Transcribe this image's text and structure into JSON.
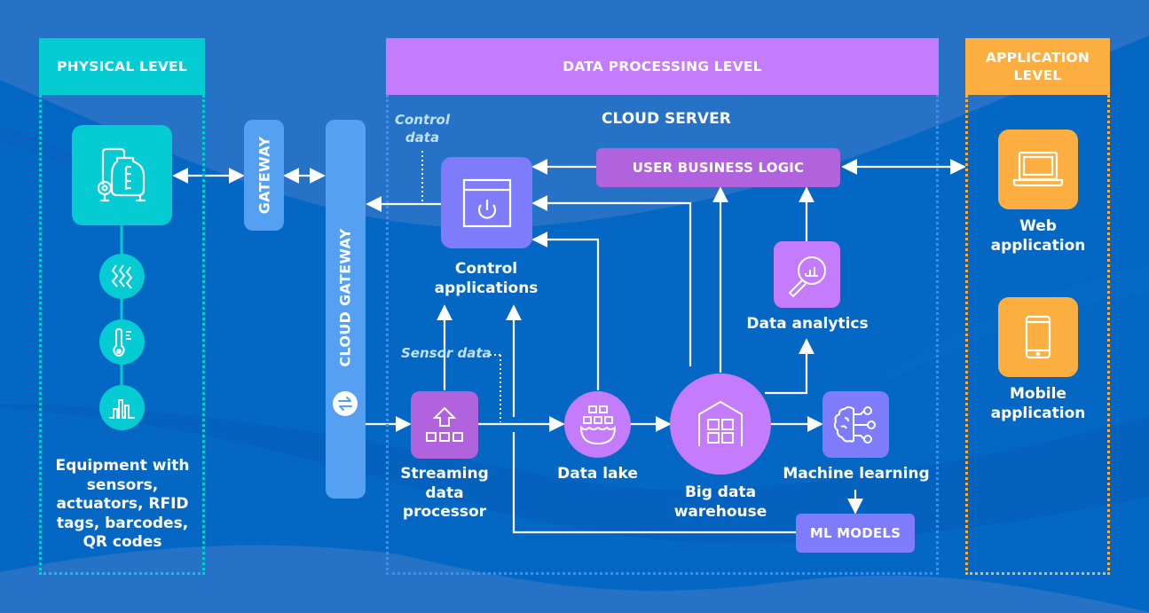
{
  "colors": {
    "background": "#0567c4",
    "background_light": "#2672c6",
    "physical": "#05cbd3",
    "processing_header": "#c47bfc",
    "application": "#fcaf40",
    "gateway": "#55a0f1",
    "control_tile": "#7e7cfb",
    "business_logic": "#b162dd",
    "analytics": "#c47bfc",
    "streaming": "#b162dd",
    "ml_tile": "#7e7cfb",
    "ml_models": "#7e7cfb"
  },
  "levels": {
    "physical": {
      "title": "PHYSICAL LEVEL"
    },
    "processing": {
      "title": "DATA PROCESSING LEVEL",
      "subtitle": "CLOUD SERVER"
    },
    "application": {
      "title": "APPLICATION LEVEL"
    }
  },
  "physical": {
    "equipment_icon": "industrial-tank-icon",
    "sensors": [
      {
        "icon": "vibration-icon"
      },
      {
        "icon": "thermometer-icon"
      },
      {
        "icon": "bar-chart-icon"
      }
    ],
    "description": "Equipment with sensors, actuators, RFID tags, barcodes, QR codes"
  },
  "gateways": {
    "gateway": "GATEWAY",
    "cloud_gateway": "CLOUD GATEWAY",
    "cloud_gateway_icon": "swap-arrows-icon"
  },
  "processing": {
    "notes": {
      "control_data": "Control data",
      "sensor_data": "Sensor data"
    },
    "nodes": {
      "control_applications": {
        "label": "Control applications",
        "icon": "power-window-icon"
      },
      "user_business_logic": {
        "label": "USER BUSINESS LOGIC"
      },
      "data_analytics": {
        "label": "Data analytics",
        "icon": "magnifier-chart-icon"
      },
      "streaming_processor": {
        "label": "Streaming data processor",
        "icon": "upload-blocks-icon"
      },
      "data_lake": {
        "label": "Data lake",
        "icon": "lake-blocks-icon"
      },
      "big_data_warehouse": {
        "label": "Big data warehouse",
        "icon": "warehouse-icon"
      },
      "machine_learning": {
        "label": "Machine learning",
        "icon": "brain-network-icon"
      },
      "ml_models": {
        "label": "ML MODELS"
      }
    }
  },
  "application": {
    "web": {
      "label": "Web application",
      "icon": "laptop-icon"
    },
    "mobile": {
      "label": "Mobile application",
      "icon": "smartphone-icon"
    }
  }
}
